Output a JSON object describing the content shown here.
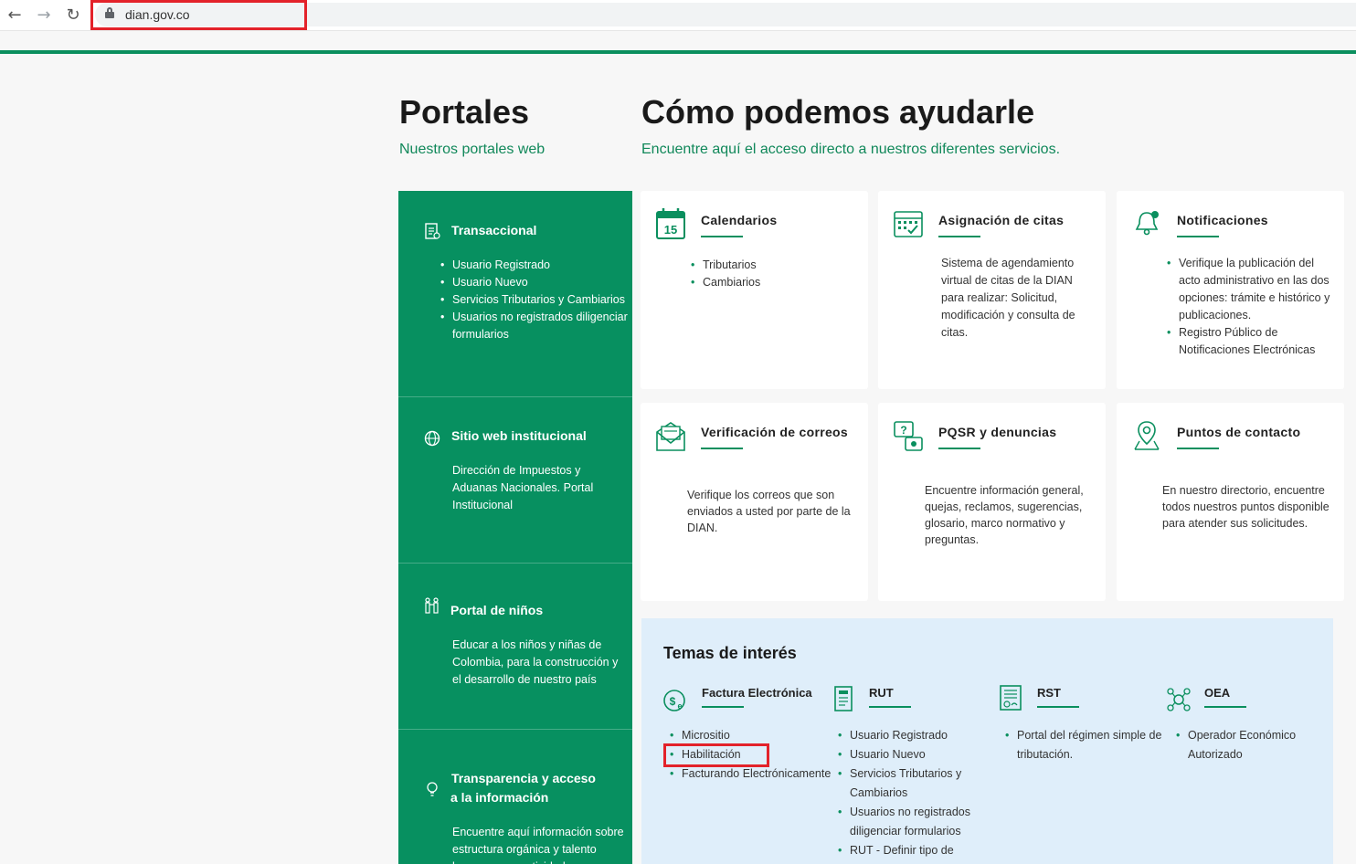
{
  "browser": {
    "url": "dian.gov.co",
    "back_icon": "arrow-left-icon",
    "forward_icon": "arrow-right-icon",
    "reload_icon": "reload-icon"
  },
  "headings": {
    "portales_title": "Portales",
    "portales_subtitle": "Nuestros portales web",
    "ayuda_title": "Cómo podemos ayudarle",
    "ayuda_subtitle": "Encuentre aquí el acceso directo a nuestros diferentes servicios."
  },
  "portals": [
    {
      "title": "Transaccional",
      "items": [
        "Usuario Registrado",
        "Usuario Nuevo",
        "Servicios Tributarios y Cambiarios",
        "Usuarios no registrados diligenciar formularios"
      ]
    },
    {
      "title": "Sitio web institucional",
      "text": "Dirección de Impuestos y Aduanas Nacionales. Portal Institucional"
    },
    {
      "title": "Portal de niños",
      "text": "Educar a los niños y niñas de Colombia, para la construcción y el desarrollo de nuestro país"
    },
    {
      "title_line1": "Transparencia y acceso",
      "title_line2": "a la información",
      "text": "Encuentre aquí información sobre estructura orgánica y talento humano, normatividad,"
    }
  ],
  "cards": {
    "calendarios": {
      "title": "Calendarios",
      "items": [
        "Tributarios",
        "Cambiarios"
      ],
      "icon_text": "15"
    },
    "citas": {
      "title": "Asignación de citas",
      "text": "Sistema de agendamiento virtual de citas de la DIAN para realizar: Solicitud, modificación y consulta de citas."
    },
    "notificaciones": {
      "title": "Notificaciones",
      "items": [
        "Verifique la publicación del acto administrativo en las dos opciones: trámite e histórico y publicaciones.",
        "Registro Público de Notificaciones Electrónicas"
      ]
    },
    "correos": {
      "title": "Verificación de correos",
      "text": "Verifique los correos que son enviados a usted por parte de la DIAN."
    },
    "pqsr": {
      "title": "PQSR y denuncias",
      "text": "Encuentre información general, quejas, reclamos, sugerencias, glosario, marco normativo y preguntas."
    },
    "contacto": {
      "title": "Puntos de contacto",
      "text": "En nuestro directorio, encuentre todos nuestros puntos disponible para atender sus solicitudes."
    }
  },
  "temas": {
    "title": "Temas de interés",
    "factura": {
      "title": "Factura Electrónica",
      "items": [
        "Micrositio",
        "Habilitación",
        "Facturando Electrónicamente"
      ]
    },
    "rut": {
      "title": "RUT",
      "items": [
        "Usuario Registrado",
        "Usuario Nuevo",
        "Servicios Tributarios y Cambiarios",
        "Usuarios no registrados diligenciar formularios",
        "RUT - Definir tipo de"
      ]
    },
    "rst": {
      "title": "RST",
      "items": [
        "Portal del régimen simple de tributación."
      ]
    },
    "oea": {
      "title": "OEA",
      "items": [
        "Operador Económico Autorizado"
      ]
    }
  },
  "colors": {
    "brand_green": "#079060",
    "highlight_red": "#e3222a",
    "temas_bg": "#dfeefa"
  }
}
